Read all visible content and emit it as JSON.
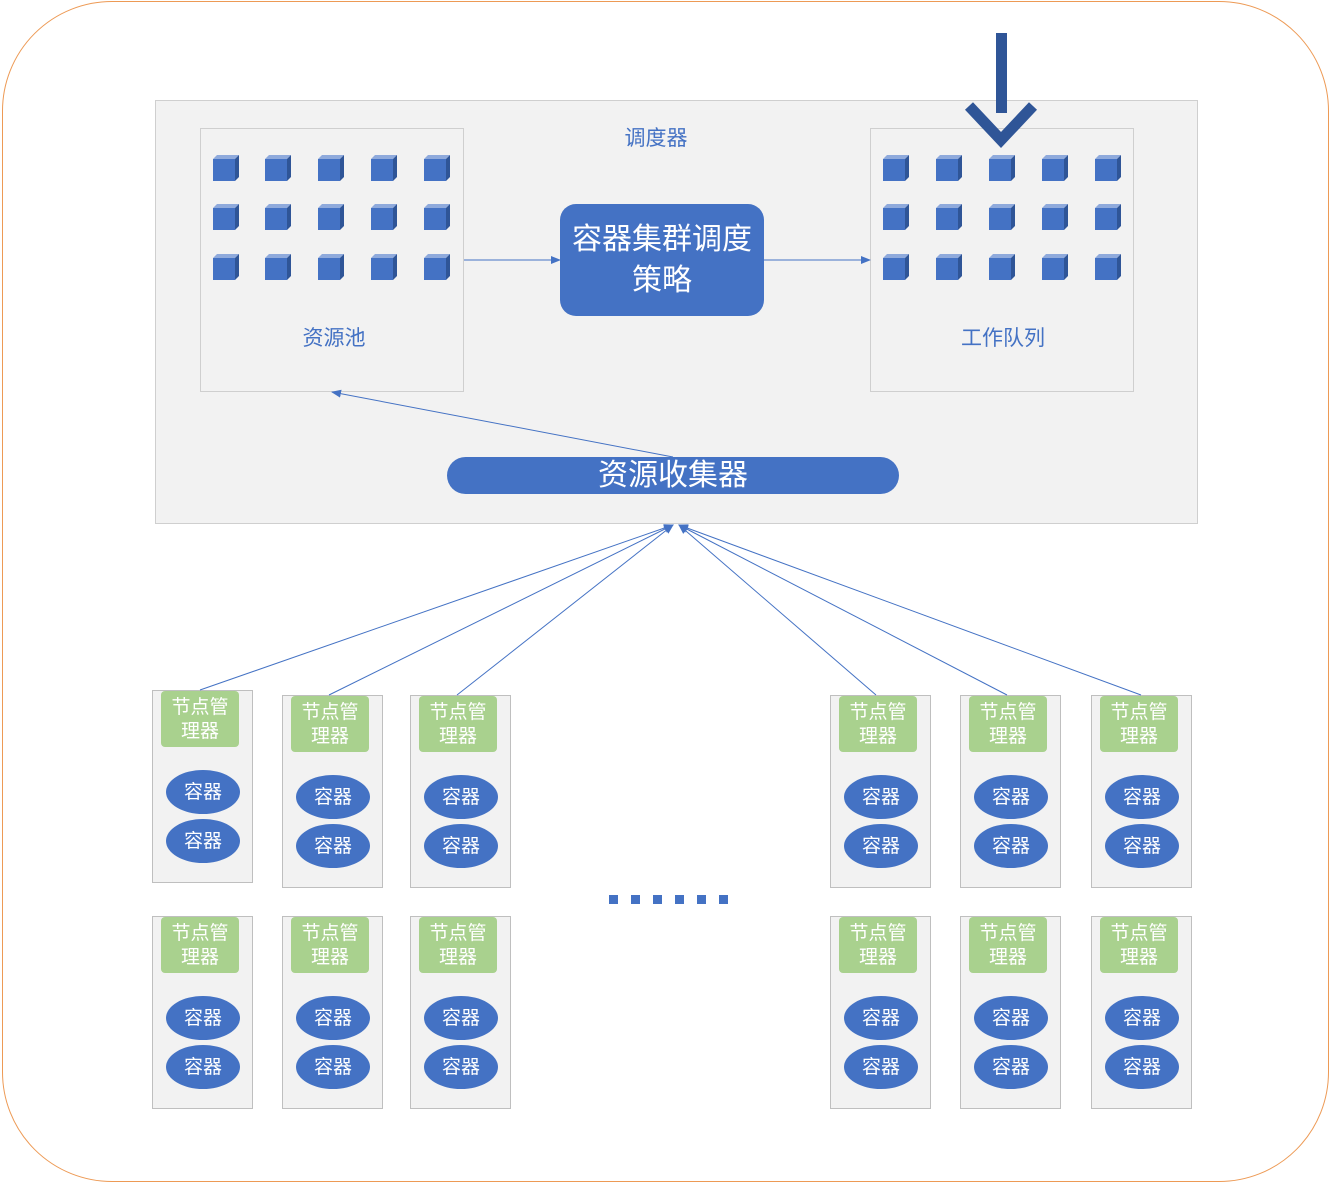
{
  "scheduler": {
    "title": "调度器"
  },
  "resource_pool": {
    "label": "资源池"
  },
  "strategy": {
    "label": "容器集群调度策略"
  },
  "work_queue": {
    "label": "工作队列"
  },
  "collector": {
    "label": "资源收集器"
  },
  "nodes": {
    "manager_label": "节点管理器",
    "container_label": "容器"
  },
  "colors": {
    "primary_blue": "#4472C4",
    "node_manager_green": "#A9D18E",
    "outer_frame_orange": "#ED9A55",
    "panel_grey": "#F2F2F2"
  }
}
